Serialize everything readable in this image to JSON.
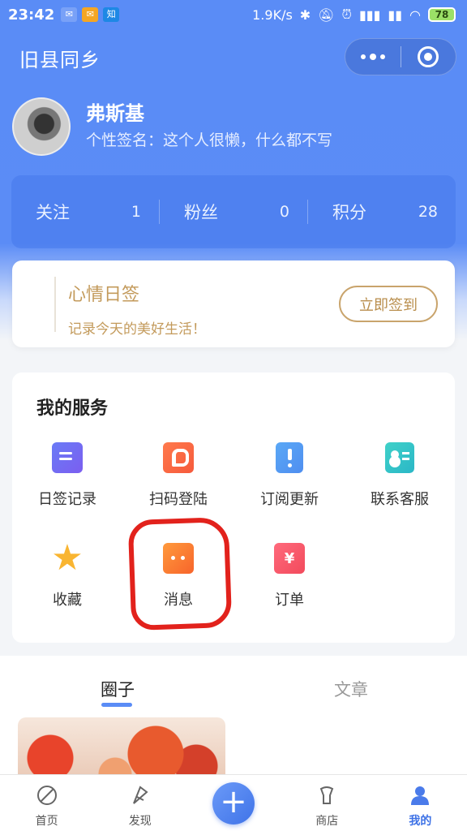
{
  "status_bar": {
    "time": "23:42",
    "net_speed": "1.9K/s",
    "battery": "78"
  },
  "header": {
    "title": "旧县同乡"
  },
  "profile": {
    "name": "弗斯基",
    "signature": "个性签名：这个人很懒，什么都不写"
  },
  "stats": [
    {
      "label": "关注",
      "value": "1"
    },
    {
      "label": "粉丝",
      "value": "0"
    },
    {
      "label": "积分",
      "value": "28"
    }
  ],
  "checkin": {
    "title": "心情日签",
    "subtitle": "记录今天的美好生活！",
    "button": "立即签到"
  },
  "services": {
    "title": "我的服务",
    "items": [
      {
        "label": "日签记录",
        "icon": "note-icon"
      },
      {
        "label": "扫码登陆",
        "icon": "scan-login-icon"
      },
      {
        "label": "订阅更新",
        "icon": "subscribe-icon"
      },
      {
        "label": "联系客服",
        "icon": "contact-icon"
      },
      {
        "label": "收藏",
        "icon": "star-icon"
      },
      {
        "label": "消息",
        "icon": "message-icon"
      },
      {
        "label": "订单",
        "icon": "order-icon"
      }
    ],
    "order_glyph": "¥"
  },
  "tabs": [
    {
      "label": "圈子",
      "active": true
    },
    {
      "label": "文章",
      "active": false
    }
  ],
  "bottom_nav": [
    {
      "label": "首页",
      "icon": "home-compass-icon"
    },
    {
      "label": "发现",
      "icon": "discover-icon"
    },
    {
      "label": "商店",
      "icon": "store-icon"
    },
    {
      "label": "我的",
      "icon": "profile-icon",
      "active": true
    }
  ],
  "colors": {
    "primary": "#5a8cf6",
    "gold": "#c39a5b",
    "annotation": "#e2221c"
  }
}
